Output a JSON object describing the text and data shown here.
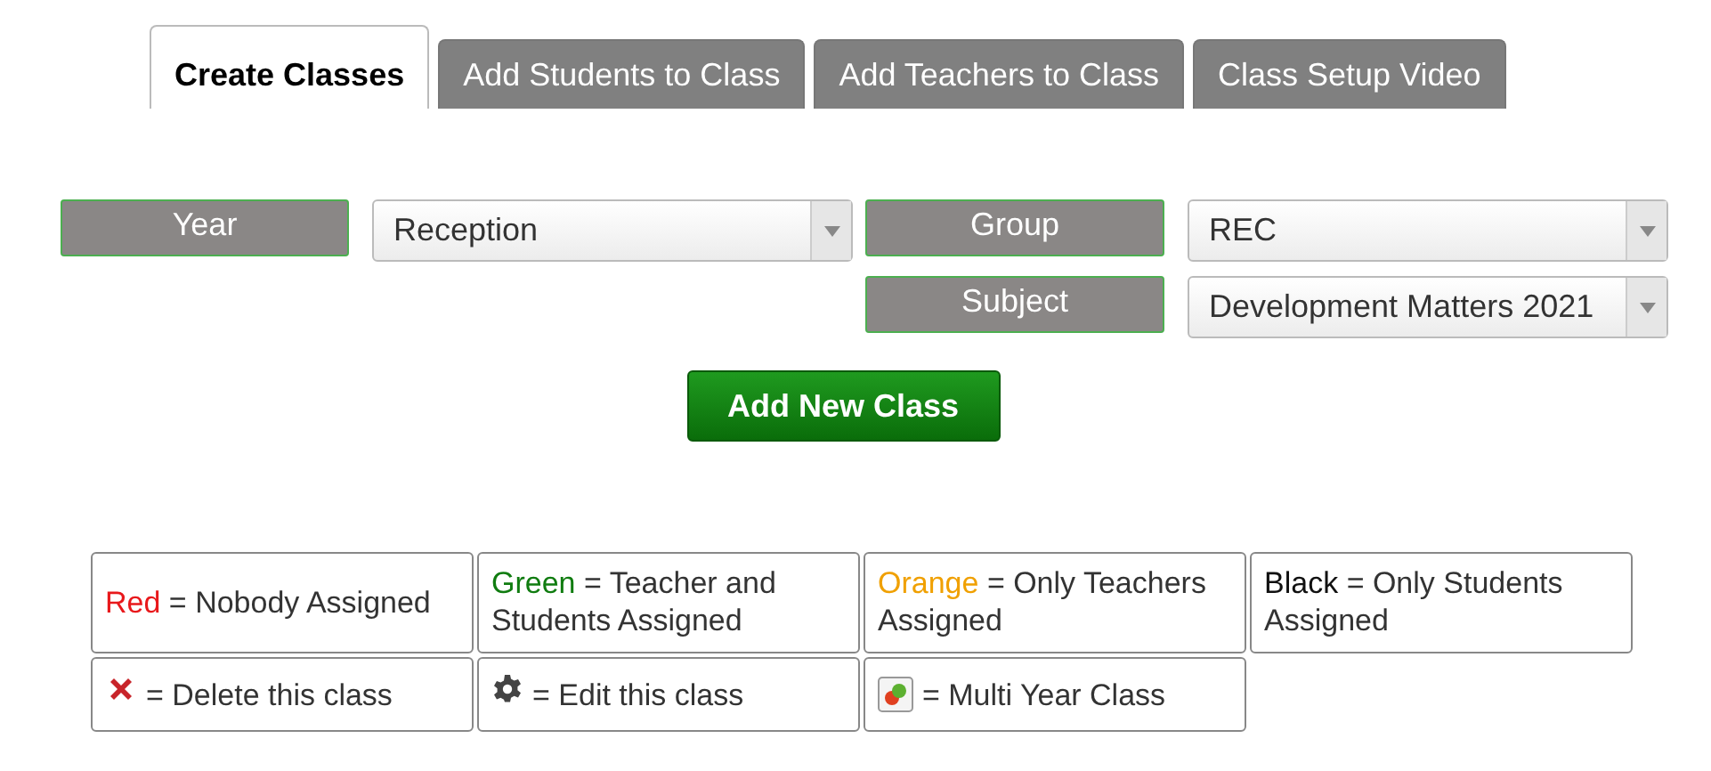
{
  "tabs": [
    {
      "label": "Create Classes",
      "selected": true
    },
    {
      "label": "Add Students to Class",
      "selected": false
    },
    {
      "label": "Add Teachers to Class",
      "selected": false
    },
    {
      "label": "Class Setup Video",
      "selected": false
    }
  ],
  "form": {
    "rows": [
      [
        {
          "label": "Year",
          "value": "Reception"
        },
        {
          "label": "Group",
          "value": "REC"
        }
      ],
      [
        null,
        {
          "label": "Subject",
          "value": "Development Matters 2021"
        }
      ]
    ],
    "button": "Add New Class"
  },
  "legend": [
    {
      "kind": "color",
      "key": "Red",
      "color": "#e8181b",
      "text": "= Nobody Assigned"
    },
    {
      "kind": "color",
      "key": "Green",
      "color": "#107c10",
      "text": "= Teacher and Students Assigned"
    },
    {
      "kind": "color",
      "key": "Orange",
      "color": "#f0a000",
      "text": "= Only Teachers Assigned"
    },
    {
      "kind": "color",
      "key": "Black",
      "color": "#111111",
      "text": "= Only Students Assigned"
    },
    {
      "kind": "delete",
      "text": "= Delete this class"
    },
    {
      "kind": "edit",
      "text": "= Edit this class"
    },
    {
      "kind": "multi",
      "text": "= Multi Year Class"
    }
  ]
}
